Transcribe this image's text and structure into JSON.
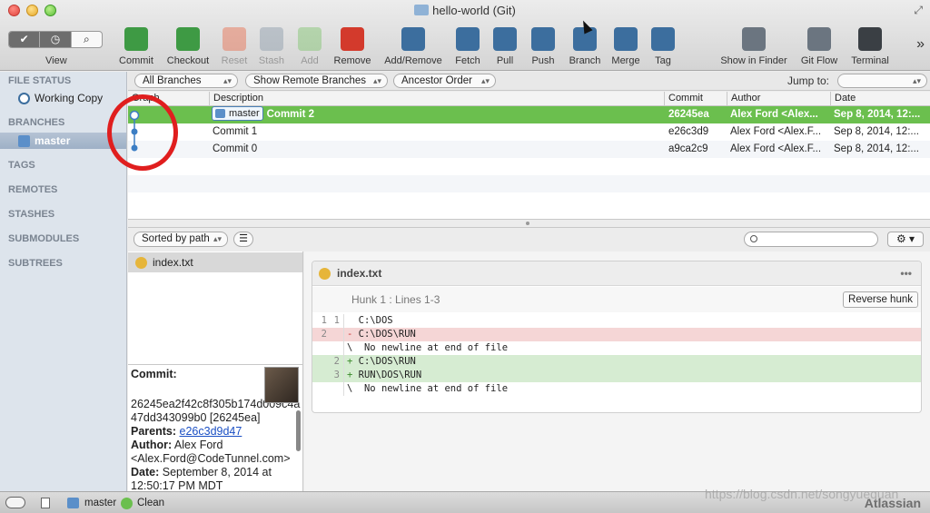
{
  "window": {
    "title": "hello-world (Git)"
  },
  "toolbar": {
    "view_label": "View",
    "view_segments": [
      "✔",
      "◷",
      "⌕"
    ],
    "buttons": [
      {
        "label": "Commit",
        "icon": "commit-icon",
        "color": "#3e9a44",
        "disabled": false
      },
      {
        "label": "Checkout",
        "icon": "checkout-icon",
        "color": "#3e9a44",
        "disabled": false
      },
      {
        "label": "Reset",
        "icon": "reset-icon",
        "color": "#e86a4a",
        "disabled": true
      },
      {
        "label": "Stash",
        "icon": "stash-icon",
        "color": "#8a9aa8",
        "disabled": true
      },
      {
        "label": "Add",
        "icon": "add-icon",
        "color": "#7cc46a",
        "disabled": true
      },
      {
        "label": "Remove",
        "icon": "remove-icon",
        "color": "#d33a2c",
        "disabled": false
      },
      {
        "label": "Add/Remove",
        "icon": "add-remove-icon",
        "color": "#3c6e9e",
        "disabled": false
      },
      {
        "label": "Fetch",
        "icon": "fetch-icon",
        "color": "#3c6e9e",
        "disabled": false
      },
      {
        "label": "Pull",
        "icon": "pull-icon",
        "color": "#3c6e9e",
        "disabled": false
      },
      {
        "label": "Push",
        "icon": "push-icon",
        "color": "#3c6e9e",
        "disabled": false
      },
      {
        "label": "Branch",
        "icon": "branch-icon",
        "color": "#3c6e9e",
        "disabled": false
      },
      {
        "label": "Merge",
        "icon": "merge-icon",
        "color": "#3c6e9e",
        "disabled": false
      },
      {
        "label": "Tag",
        "icon": "tag-icon",
        "color": "#3c6e9e",
        "disabled": false
      },
      {
        "label": "Show in Finder",
        "icon": "finder-icon",
        "color": "#6b7580",
        "disabled": false
      },
      {
        "label": "Git Flow",
        "icon": "git-flow-icon",
        "color": "#6b7580",
        "disabled": false
      },
      {
        "label": "Terminal",
        "icon": "terminal-icon",
        "color": "#3a3f44",
        "disabled": false
      }
    ],
    "overflow": "»"
  },
  "sidebar": {
    "file_status": {
      "heading": "FILE STATUS",
      "item": "Working Copy"
    },
    "branches": {
      "heading": "BRANCHES",
      "item": "master"
    },
    "sections": [
      "TAGS",
      "REMOTES",
      "STASHES",
      "SUBMODULES",
      "SUBTREES"
    ]
  },
  "filters": {
    "branches": "All Branches",
    "remote": "Show Remote Branches",
    "order": "Ancestor Order",
    "jump_label": "Jump to:",
    "jump_value": ""
  },
  "columns": {
    "graph": "Graph",
    "description": "Description",
    "commit": "Commit",
    "author": "Author",
    "date": "Date"
  },
  "commits": [
    {
      "branch": "master",
      "description": "Commit 2",
      "hash": "26245ea",
      "author": "Alex Ford <Alex...",
      "date": "Sep 8, 2014, 12:..."
    },
    {
      "branch": "",
      "description": "Commit 1",
      "hash": "e26c3d9",
      "author": "Alex Ford <Alex.F...",
      "date": "Sep 8, 2014, 12:..."
    },
    {
      "branch": "",
      "description": "Commit 0",
      "hash": "a9ca2c9",
      "author": "Alex Ford <Alex.F...",
      "date": "Sep 8, 2014, 12:..."
    }
  ],
  "lower_toolbar": {
    "sort": "Sorted by path",
    "search_placeholder": "",
    "gear": "⚙"
  },
  "files": [
    {
      "name": "index.txt"
    }
  ],
  "commit_details": {
    "commit_label": "Commit:",
    "hash_full": "26245ea2f42c8f305b174d009c4a47dd343099b0 [26245ea]",
    "parents_label": "Parents:",
    "parents": "e26c3d9d47",
    "author_label": "Author:",
    "author": "Alex Ford <Alex.Ford@CodeTunnel.com>",
    "date_label": "Date:",
    "date": "September 8, 2014 at 12:50:17 PM MDT"
  },
  "diff": {
    "file": "index.txt",
    "more": "•••",
    "hunk_title": "Hunk 1 : Lines 1-3",
    "reverse_label": "Reverse hunk",
    "lines": [
      {
        "type": "ctx",
        "old": "1",
        "new": "1",
        "mark": " ",
        "text": "C:\\DOS"
      },
      {
        "type": "del",
        "old": "2",
        "new": "",
        "mark": "-",
        "text": "C:\\DOS\\RUN"
      },
      {
        "type": "meta",
        "old": "",
        "new": "",
        "mark": "\\",
        "text": " No newline at end of file"
      },
      {
        "type": "add",
        "old": "",
        "new": "2",
        "mark": "+",
        "text": "C:\\DOS\\RUN"
      },
      {
        "type": "add",
        "old": "",
        "new": "3",
        "mark": "+",
        "text": "RUN\\DOS\\RUN"
      },
      {
        "type": "meta",
        "old": "",
        "new": "",
        "mark": "\\",
        "text": " No newline at end of file"
      }
    ]
  },
  "statusbar": {
    "branch": "master",
    "state": "Clean",
    "brand": "Atlassian"
  },
  "watermark": "https://blog.csdn.net/songyuequan",
  "colors": {
    "selected_row": "#6bbf4e",
    "accent_blue": "#3c6e9e",
    "annotation_red": "#e01e1e"
  }
}
